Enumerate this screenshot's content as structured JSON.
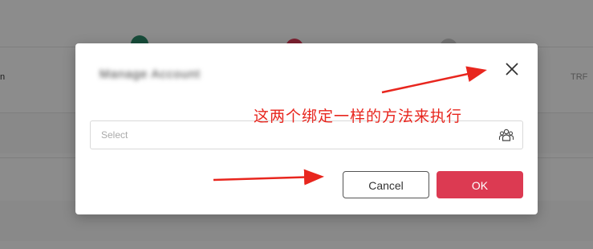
{
  "background": {
    "left_label": "n",
    "right_label": "TRF",
    "dot_colors": [
      "#2d8a6b",
      "#e23d5a",
      "#cfcfcf"
    ]
  },
  "dialog": {
    "title": "Manage Account",
    "close_icon": "close-icon",
    "select": {
      "placeholder": "Select",
      "icon": "users-group-icon"
    },
    "cancel_label": "Cancel",
    "ok_label": "OK",
    "ok_color": "#dc3a52"
  },
  "annotation": {
    "text": "这两个绑定一样的方法来执行",
    "color": "#e8261e"
  }
}
